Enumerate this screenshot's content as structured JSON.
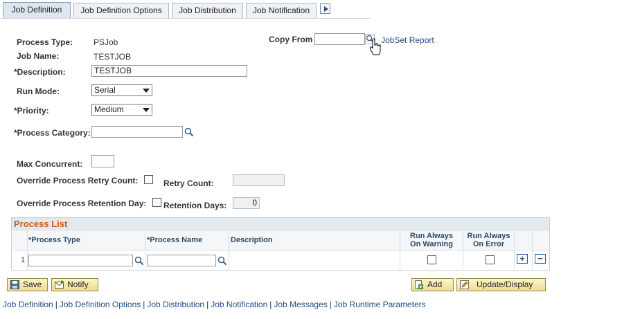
{
  "tabs": [
    {
      "label": "Job Definition",
      "active": true
    },
    {
      "label": "Job Definition Options",
      "active": false
    },
    {
      "label": "Job Distribution",
      "active": false
    },
    {
      "label": "Job Notification",
      "active": false
    }
  ],
  "tab_scroll_icon": "scroll-right-icon",
  "form": {
    "process_type_label": "Process Type:",
    "process_type_value": "PSJob",
    "job_name_label": "Job Name:",
    "job_name_value": "TESTJOB",
    "description_label": "*Description:",
    "description_value": "TESTJOB",
    "run_mode_label": "Run Mode:",
    "run_mode_value": "Serial",
    "priority_label": "*Priority:",
    "priority_value": "Medium",
    "process_category_label": "*Process Category:",
    "process_category_value": "",
    "max_concurrent_label": "Max Concurrent:",
    "max_concurrent_value": "",
    "override_retry_label": "Override Process Retry Count:",
    "retry_count_label": "Retry Count:",
    "retry_count_value": "",
    "override_retention_label": "Override Process Retention Day:",
    "retention_days_label": "Retention Days:",
    "retention_days_value": "0",
    "copy_from_label": "Copy From",
    "copy_from_value": "",
    "jobset_report_link": "JobSet Report"
  },
  "process_list": {
    "title": "Process List",
    "columns": {
      "process_type": "*Process Type",
      "process_name": "*Process Name",
      "description": "Description",
      "run_always_warning_1": "Run Always",
      "run_always_warning_2": "On Warning",
      "run_always_error_1": "Run Always",
      "run_always_error_2": "On Error"
    },
    "rows": [
      {
        "num": "1",
        "process_type": "",
        "process_name": "",
        "description": ""
      }
    ],
    "add_row": "+",
    "delete_row": "−"
  },
  "buttons": {
    "save": "Save",
    "notify": "Notify",
    "add": "Add",
    "update_display": "Update/Display"
  },
  "bottom_links": [
    "Job Definition",
    "Job Definition Options",
    "Job Distribution",
    "Job Notification",
    "Job Messages",
    "Job Runtime Parameters"
  ],
  "colors": {
    "accent_orange": "#c95a1a",
    "link_blue": "#1d4e89",
    "button_yellow": "#efdd8f"
  }
}
